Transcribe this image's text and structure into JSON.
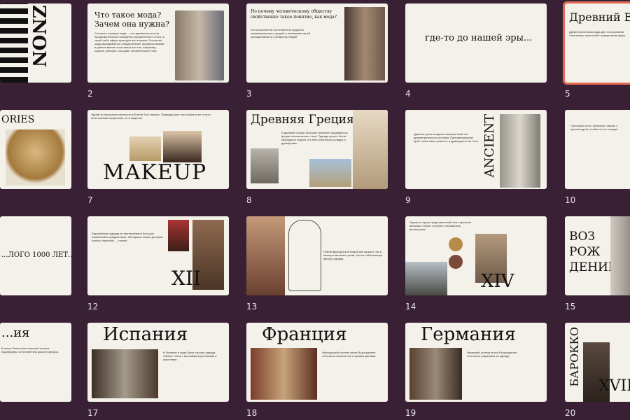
{
  "slides": [
    {
      "num": "",
      "title": "",
      "big": "ZNON"
    },
    {
      "num": "2",
      "title": "Что такое мода?\nЗачем она нужна?",
      "body": "Согласно словарю мода — это временное или не продолжительное господство определенного стиля, в какой-либо сфере культуры или в жизни. В понятие моды вкладывается определенный, предпочитаемый в данное время стиль вещи или тип, например, мужчин, женщин, или даже человеческого тела."
    },
    {
      "num": "3",
      "title": "Но почему человеческому обществу свойственно такое понятие, как мода?",
      "body": "Это объясняется естественной нуждой в самовыражении и нуждой в понимании своей принадлежности к обществу людей."
    },
    {
      "num": "4",
      "title": "где-то до нашей эры..."
    },
    {
      "num": "5",
      "title": "Древний Египет",
      "body": "Древнеегипетская мода для того времени отличалась простотой и изяществом форм."
    },
    {
      "num": "",
      "title": "ORIES"
    },
    {
      "num": "7",
      "title": "",
      "big": "MAKEUP",
      "body": "Одним из признаков знатности в Египте был макияж. Подводка для глаз служила не только эстетическим средством, но и защитой."
    },
    {
      "num": "8",
      "title": "Древняя Греция",
      "body": "В древней Греции большое значение придавалось форме человеческого тела. Одежда просто была свободного покроя, и в ней сочетались складки и драпировки."
    },
    {
      "num": "9",
      "title": "",
      "big": "ANCIENT",
      "body": "Древние греки создали совершенный тип древнегреческого костюма. Принципиальный крой: ткань мало режется, а драпируется на теле."
    },
    {
      "num": "10",
      "title": "",
      "body": "Греческий хитон органично связан с архитектурой, особенно его складки."
    },
    {
      "num": "",
      "title": "...ЛОГО 1000 ЛЕТ..."
    },
    {
      "num": "12",
      "title": "",
      "big": "XII",
      "body": "Европейская одежда не претерпевала больших изменений в средние века. Женщины носили длинные платья, мужчины — туники."
    },
    {
      "num": "13",
      "title": "",
      "body": "Новой французской модой как мужчин, так и женщин являлась узкая, плотно облегающая фигуру одежда."
    },
    {
      "num": "14",
      "title": "",
      "big": "XIV",
      "body": "Одним из ярких представителей этого времени являлась готика. Силуэты становились вытянутыми."
    },
    {
      "num": "15",
      "title": "",
      "big": "ВОЗ РОЖ ДЕНИЕ"
    },
    {
      "num": "",
      "title": "...ия",
      "body": "В эпоху Ренессанса женский костюм подчёркивал естественную красоту фигуры."
    },
    {
      "num": "17",
      "title": "Испания",
      "body": "В Испании в моде была строгая одежда тёмных тонов с высокими воротниками и корсетами."
    },
    {
      "num": "18",
      "title": "Франция",
      "body": "Французский костюм эпохи Возрождения отличался пышностью и яркими цветами."
    },
    {
      "num": "19",
      "title": "Германия",
      "body": "Немецкий костюм эпохи Возрождения отличался разрезами на одежде."
    },
    {
      "num": "20",
      "title": "",
      "big": "БАРОККО",
      "big2": "XVIII"
    }
  ]
}
